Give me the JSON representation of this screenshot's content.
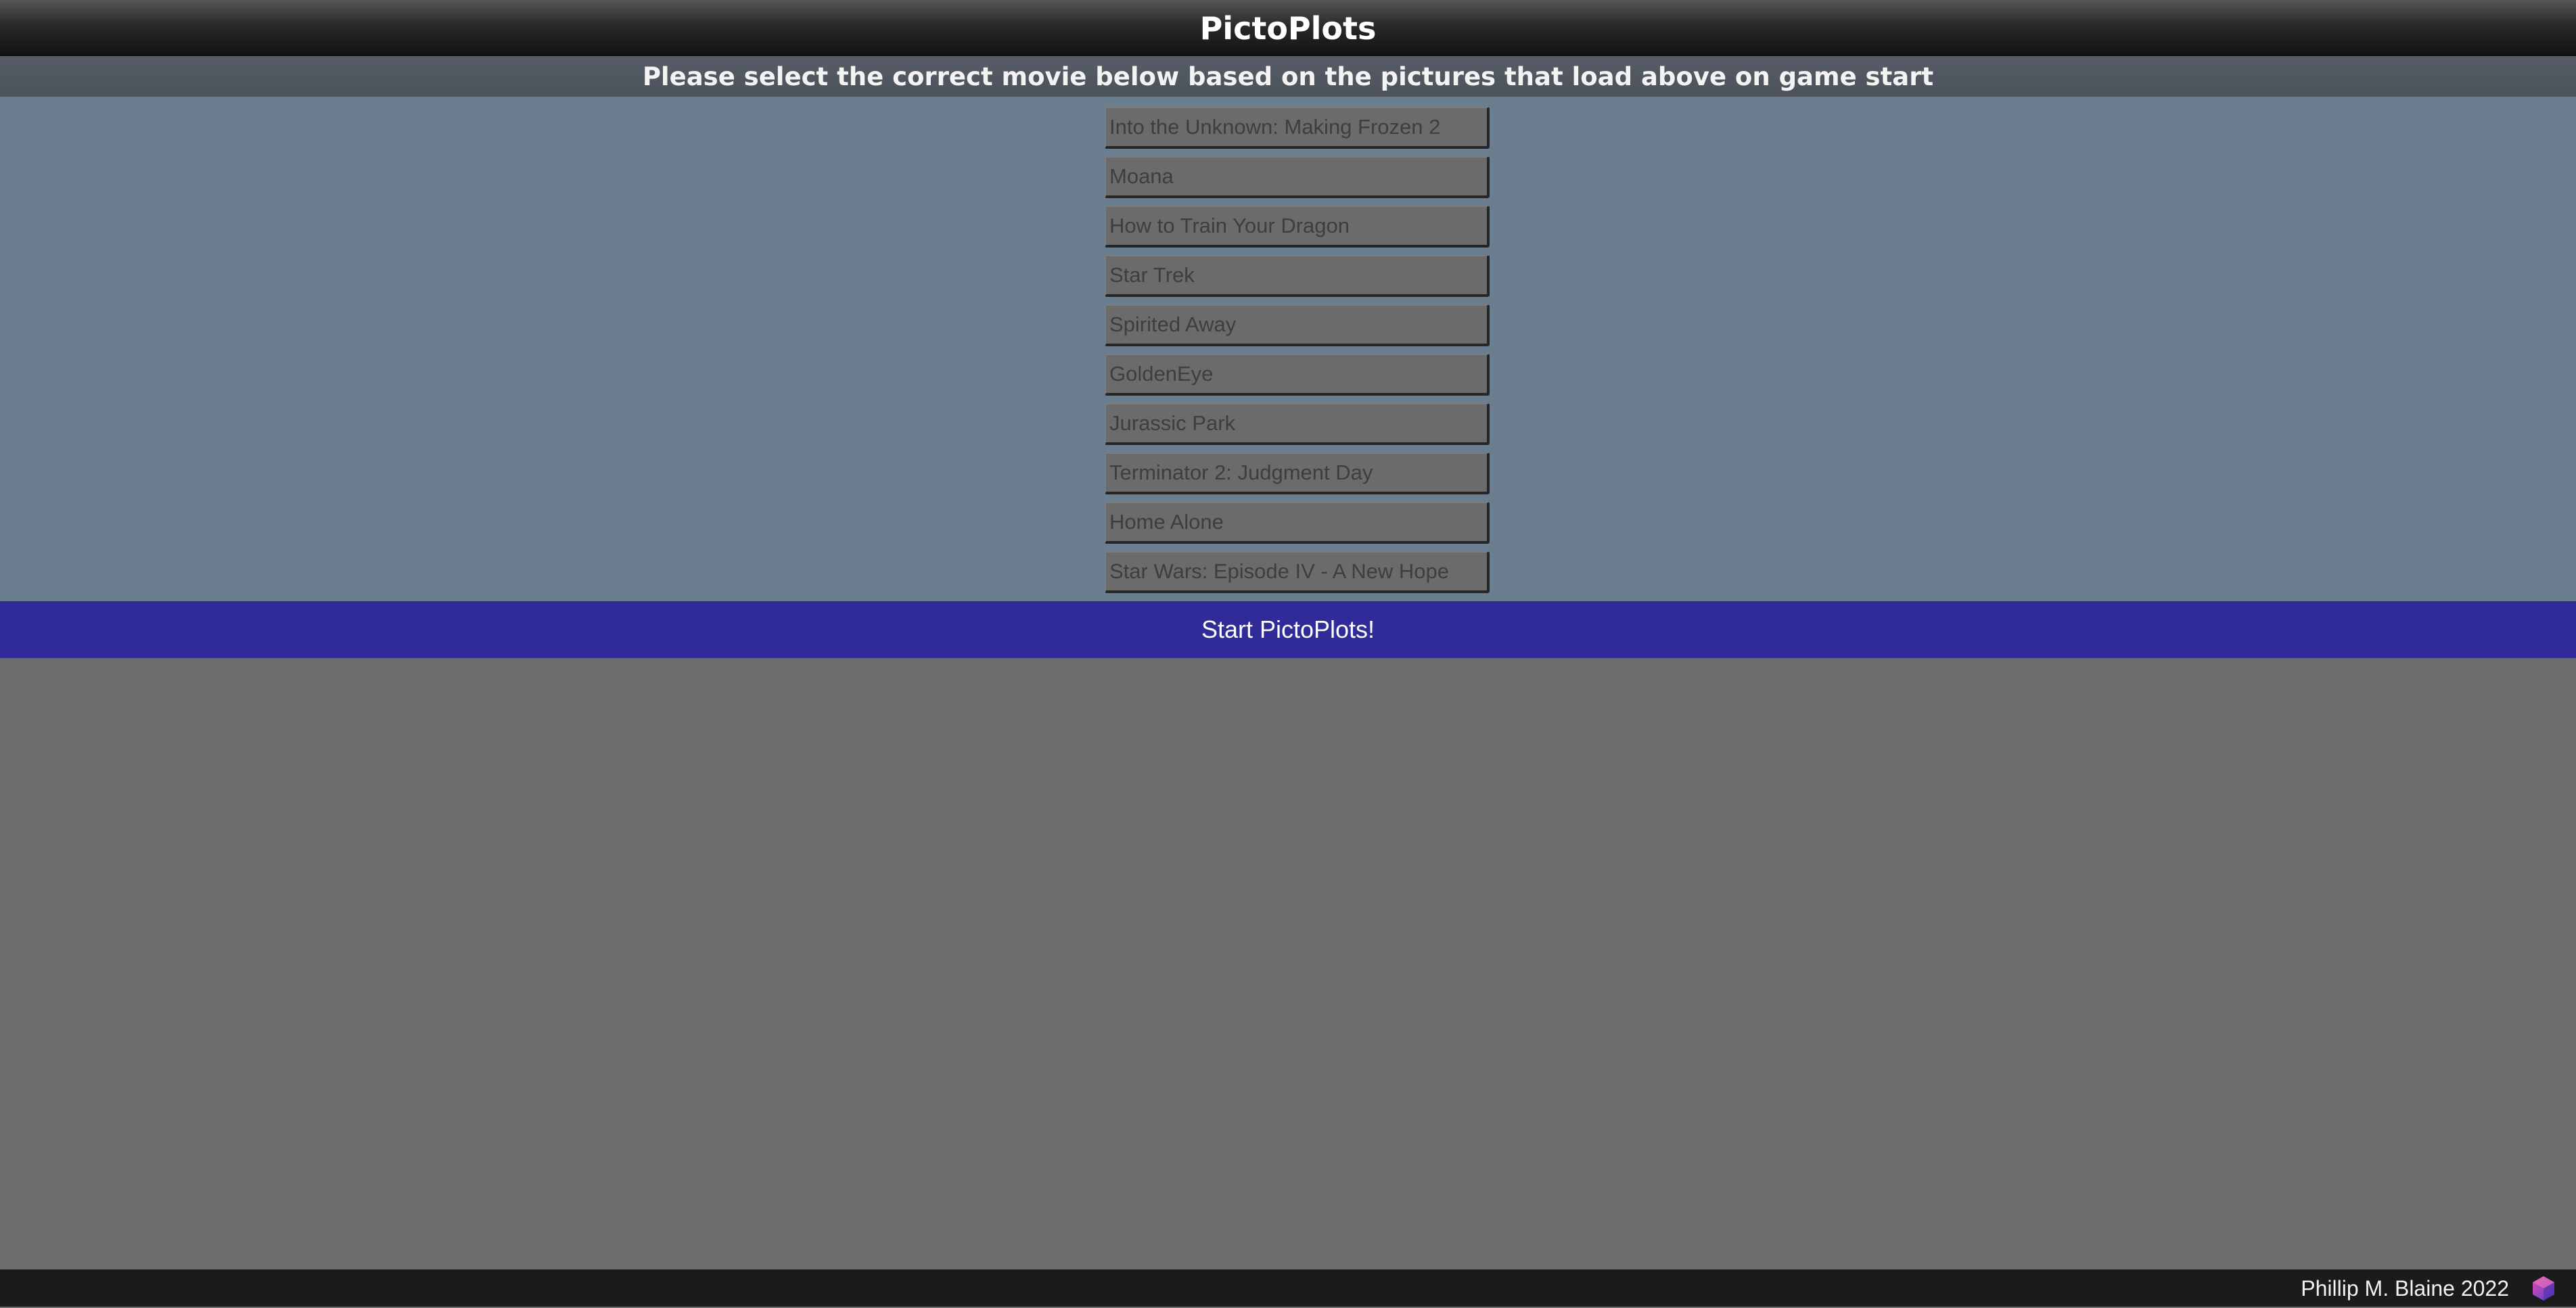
{
  "header": {
    "title": "PictoPlots"
  },
  "instructions": {
    "text": "Please select the correct movie below based on the pictures that load above on game start"
  },
  "options": [
    {
      "label": "Into the Unknown: Making Frozen 2"
    },
    {
      "label": "Moana"
    },
    {
      "label": "How to Train Your Dragon"
    },
    {
      "label": "Star Trek"
    },
    {
      "label": "Spirited Away"
    },
    {
      "label": "GoldenEye"
    },
    {
      "label": "Jurassic Park"
    },
    {
      "label": "Terminator 2: Judgment Day"
    },
    {
      "label": "Home Alone"
    },
    {
      "label": "Star Wars: Episode IV - A New Hope"
    }
  ],
  "start": {
    "label": "Start PictoPlots!"
  },
  "footer": {
    "credit": "Phillip M. Blaine 2022",
    "logo_icon": "hexagon-cube-logo-icon"
  },
  "colors": {
    "options_panel_bg": "#6b7e8f",
    "start_bar_bg": "#2f2b98",
    "game_area_bg": "#6d6d6d",
    "footer_bg": "#1b1b1b",
    "logo_gradient": [
      "#d63fa0",
      "#6a3fd6"
    ]
  }
}
